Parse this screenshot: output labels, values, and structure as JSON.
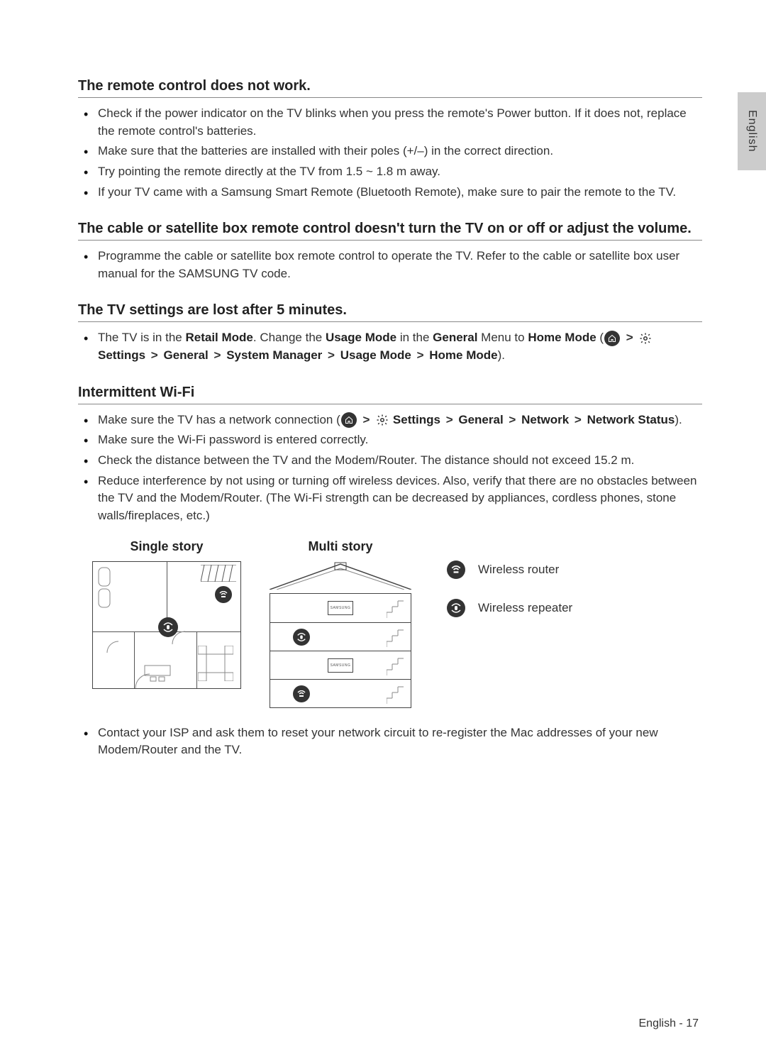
{
  "language_tab": "English",
  "sections": {
    "remote": {
      "title": "The remote control does not work.",
      "items": [
        "Check if the power indicator on the TV blinks when you press the remote's Power button. If it does not, replace the remote control's batteries.",
        "Make sure that the batteries are installed with their poles (+/–) in the correct direction.",
        "Try pointing the remote directly at the TV from 1.5 ~ 1.8 m away.",
        "If your TV came with a Samsung Smart Remote (Bluetooth Remote), make sure to pair the remote to the TV."
      ]
    },
    "cable": {
      "title": "The cable or satellite box remote control doesn't turn the TV on or off or adjust the volume.",
      "items": [
        "Programme the cable or satellite box remote control to operate the TV. Refer to the cable or satellite box user manual for the SAMSUNG TV code."
      ]
    },
    "settings_lost": {
      "title": "The TV settings are lost after 5 minutes.",
      "item_prefix": "The TV is in the ",
      "retail_mode": "Retail Mode",
      "change_text": ". Change the ",
      "usage_mode": "Usage Mode",
      "in_the": " in the ",
      "general": "General",
      "menu_to": " Menu to ",
      "home_mode": "Home Mode",
      "settings": "Settings",
      "general2": "General",
      "system_manager": "System Manager",
      "usage_mode2": "Usage Mode",
      "home_mode2": "Home Mode"
    },
    "wifi": {
      "title": "Intermittent Wi-Fi",
      "conn_prefix": "Make sure the TV has a network connection (",
      "settings": "Settings",
      "general": "General",
      "network": "Network",
      "network_status": "Network Status",
      "items_rest": [
        "Make sure the Wi-Fi password is entered correctly.",
        "Check the distance between the TV and the Modem/Router. The distance should not exceed 15.2 m.",
        "Reduce interference by not using or turning off wireless devices. Also, verify that there are no obstacles between the TV and the Modem/Router. (The Wi-Fi strength can be decreased by appliances, cordless phones, stone walls/fireplaces, etc.)"
      ],
      "diagrams": {
        "single_story": "Single story",
        "multi_story": "Multi story",
        "tv_label": "SAMSUNG"
      },
      "legend": {
        "router": "Wireless router",
        "repeater": "Wireless repeater"
      },
      "last_item": "Contact your ISP and ask them to reset your network circuit to re-register the Mac addresses of your new Modem/Router and the TV."
    }
  },
  "separator": ">",
  "footer": {
    "lang": "English",
    "sep": " - ",
    "page": "17"
  }
}
